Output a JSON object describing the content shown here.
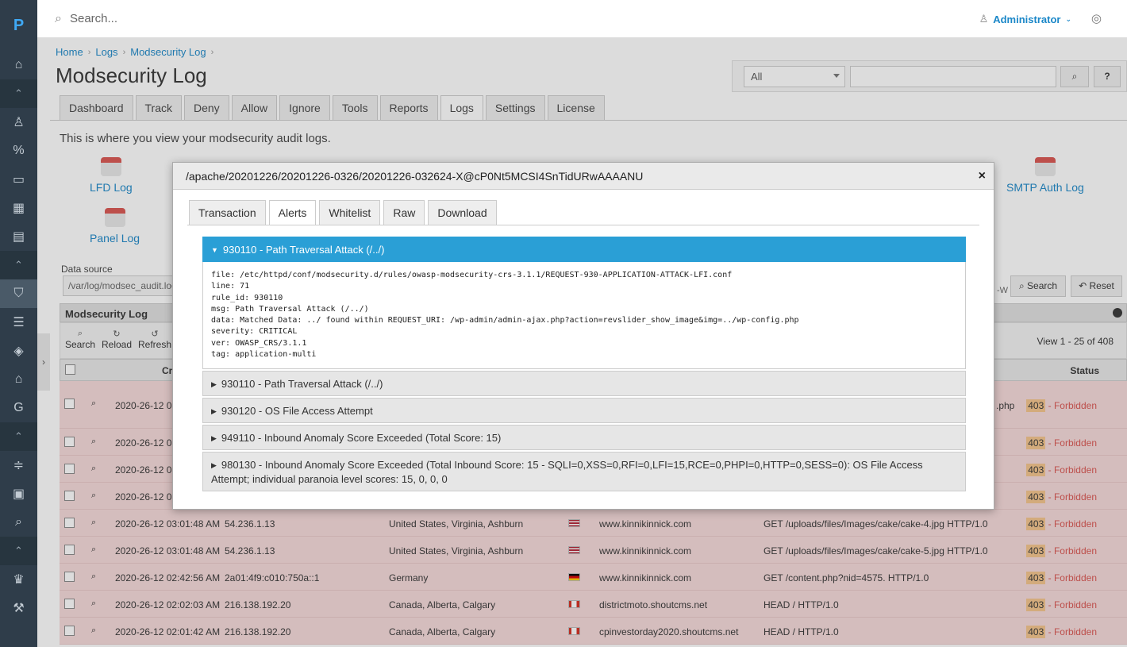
{
  "app": {
    "logo": "P"
  },
  "topbar": {
    "search_placeholder": "Search...",
    "user": "Administrator"
  },
  "breadcrumb": [
    "Home",
    "Logs",
    "Modsecurity Log"
  ],
  "page_title": "Modsecurity Log",
  "filter": {
    "select_value": "All"
  },
  "tabs": [
    "Dashboard",
    "Track",
    "Deny",
    "Allow",
    "Ignore",
    "Tools",
    "Reports",
    "Logs",
    "Settings",
    "License"
  ],
  "active_tab": "Logs",
  "intro": "This is where you view your modsecurity audit logs.",
  "log_links": {
    "lfd": "LFD Log",
    "panel": "Panel Log",
    "smtp": "SMTP Auth Log"
  },
  "data_source": {
    "label": "Data source",
    "value": "/var/log/modsec_audit.log"
  },
  "search_btn": "Search",
  "reset_btn": "Reset",
  "w_text": "-W",
  "grid": {
    "title": "Modsecurity Log",
    "tools": [
      "Search",
      "Reload",
      "Refresh"
    ],
    "view_count": "View 1 - 25 of 408",
    "col_created": "Crea",
    "col_status": "Status",
    "rows": [
      {
        "date": "2020-26-12 03",
        "ip": "",
        "loc": "",
        "host": "",
        "req": ".php",
        "code": "403",
        "status": "- Forbidden"
      },
      {
        "date": "2020-26-12 03",
        "ip": "",
        "loc": "",
        "host": "",
        "req": "",
        "code": "403",
        "status": "- Forbidden"
      },
      {
        "date": "2020-26-12 03",
        "ip": "",
        "loc": "",
        "host": "",
        "req": "",
        "code": "403",
        "status": "- Forbidden"
      },
      {
        "date": "2020-26-12 03",
        "ip": "",
        "loc": "",
        "host": "",
        "req": "",
        "code": "403",
        "status": "- Forbidden"
      },
      {
        "date": "2020-26-12 03:01:48 AM",
        "ip": "54.236.1.13",
        "loc": "United States, Virginia, Ashburn",
        "flag": "us",
        "host": "www.kinnikinnick.com",
        "req": "GET /uploads/files/Images/cake/cake-4.jpg HTTP/1.0",
        "code": "403",
        "status": "- Forbidden"
      },
      {
        "date": "2020-26-12 03:01:48 AM",
        "ip": "54.236.1.13",
        "loc": "United States, Virginia, Ashburn",
        "flag": "us",
        "host": "www.kinnikinnick.com",
        "req": "GET /uploads/files/Images/cake/cake-5.jpg HTTP/1.0",
        "code": "403",
        "status": "- Forbidden"
      },
      {
        "date": "2020-26-12 02:42:56 AM",
        "ip": "2a01:4f9:c010:750a::1",
        "loc": "Germany",
        "flag": "de",
        "host": "www.kinnikinnick.com",
        "req": "GET /content.php?nid=4575. HTTP/1.0",
        "code": "403",
        "status": "- Forbidden"
      },
      {
        "date": "2020-26-12 02:02:03 AM",
        "ip": "216.138.192.20",
        "loc": "Canada, Alberta, Calgary",
        "flag": "ca",
        "host": "districtmoto.shoutcms.net",
        "req": "HEAD / HTTP/1.0",
        "code": "403",
        "status": "- Forbidden"
      },
      {
        "date": "2020-26-12 02:01:42 AM",
        "ip": "216.138.192.20",
        "loc": "Canada, Alberta, Calgary",
        "flag": "ca",
        "host": "cpinvestorday2020.shoutcms.net",
        "req": "HEAD / HTTP/1.0",
        "code": "403",
        "status": "- Forbidden"
      }
    ]
  },
  "modal": {
    "title": "/apache/20201226/20201226-0326/20201226-032624-X@cP0Nt5MCSI4SnTidURwAAAANU",
    "close": "×",
    "tabs": [
      "Transaction",
      "Alerts",
      "Whitelist",
      "Raw",
      "Download"
    ],
    "active_tab": "Alerts",
    "alerts": [
      {
        "title": "930110 - Path Traversal Attack (/../)",
        "open": true,
        "body": "file: /etc/httpd/conf/modsecurity.d/rules/owasp-modsecurity-crs-3.1.1/REQUEST-930-APPLICATION-ATTACK-LFI.conf\nline: 71\nrule_id: 930110\nmsg: Path Traversal Attack (/../)\ndata: Matched Data: ../ found within REQUEST_URI: /wp-admin/admin-ajax.php?action=revslider_show_image&img=../wp-config.php\nseverity: CRITICAL\nver: OWASP_CRS/3.1.1\ntag: application-multi"
      },
      {
        "title": "930110 - Path Traversal Attack (/../)"
      },
      {
        "title": "930120 - OS File Access Attempt"
      },
      {
        "title": "949110 - Inbound Anomaly Score Exceeded (Total Score: 15)"
      },
      {
        "title": "980130 - Inbound Anomaly Score Exceeded (Total Inbound Score: 15 - SQLI=0,XSS=0,RFI=0,LFI=15,RCE=0,PHPI=0,HTTP=0,SESS=0): OS File Access Attempt; individual paranoia level scores: 15, 0, 0, 0"
      }
    ]
  },
  "colors": {
    "accent": "#2a9fd6",
    "sidebar": "#2f3d4a",
    "row_bg": "#f6dada",
    "forbidden": "#d9534f",
    "code_bg": "#f5c48a"
  }
}
